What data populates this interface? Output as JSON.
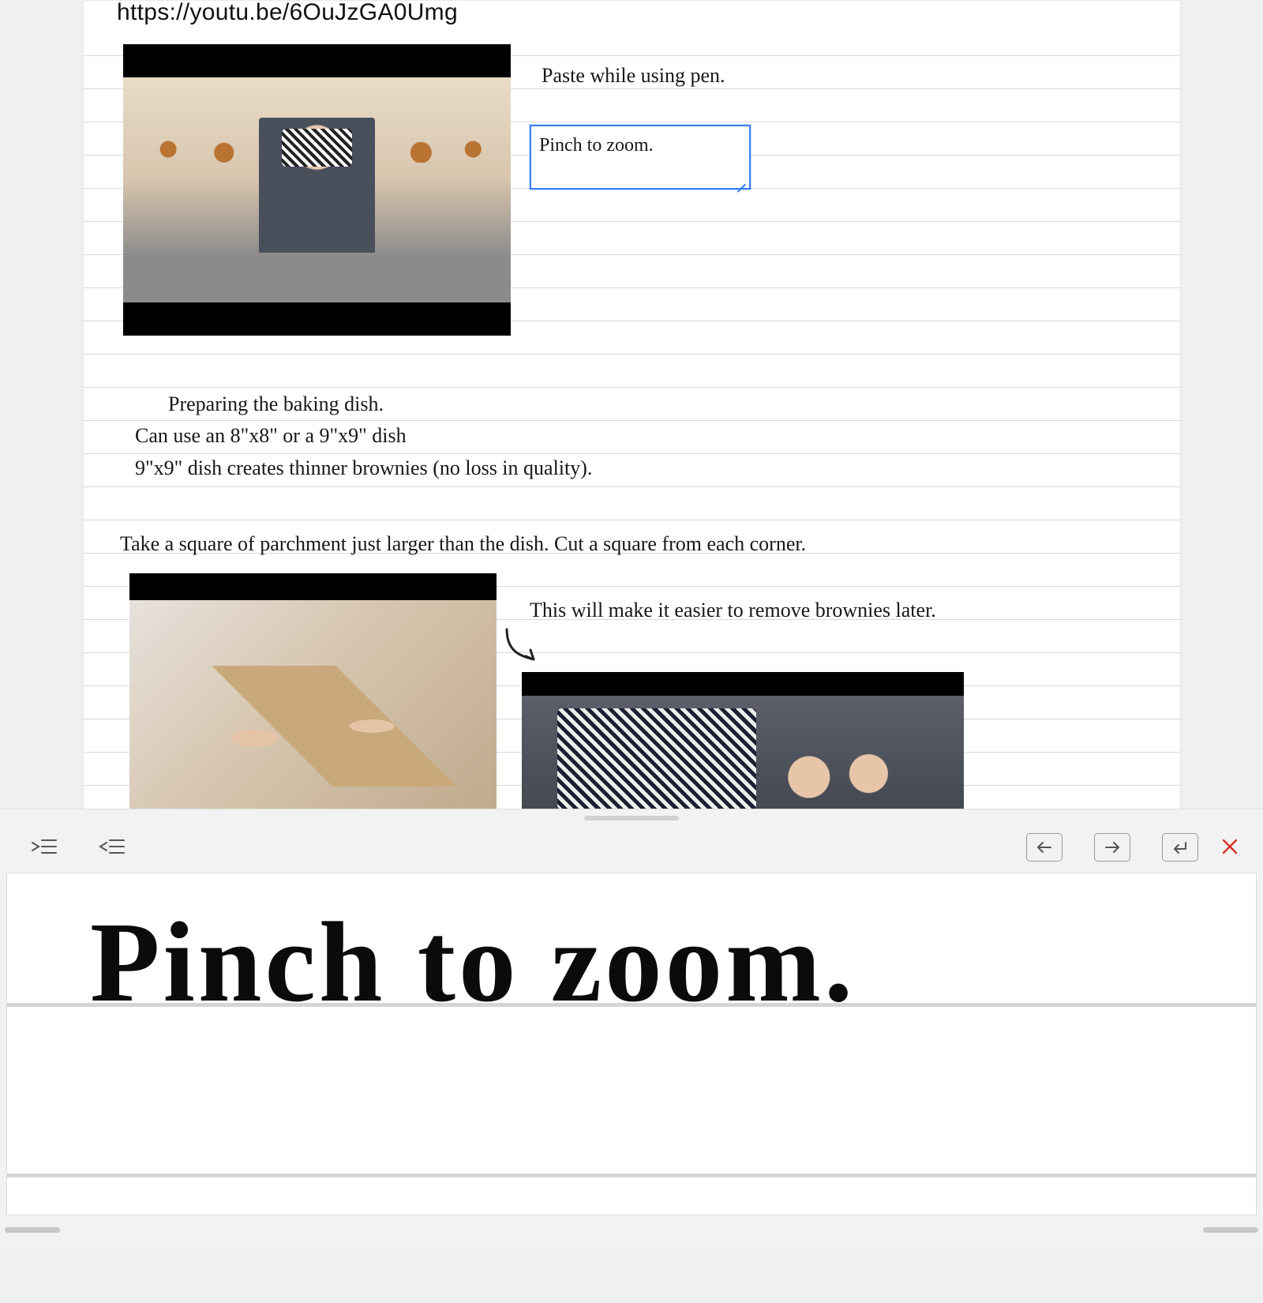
{
  "url": "https://youtu.be/6OuJzGA0Umg",
  "notes": {
    "paste_line": "Paste while using pen.",
    "zoom_box": "Pinch to zoom.",
    "prep_heading": "Preparing the baking dish.",
    "prep_l1": "Can use an 8\"x8\" or a 9\"x9\" dish",
    "prep_l2": "9\"x9\" dish creates thinner brownies (no loss in quality).",
    "parchment": "Take a square of parchment just larger than the dish. Cut a square from each corner.",
    "annot_remove": "This will make it easier to remove brownies later."
  },
  "panel": {
    "zoom_text": "Pinch to zoom.",
    "buttons": {
      "indent_right": "Indent right",
      "indent_left": "Indent left",
      "prev": "Previous",
      "next": "Next",
      "return": "Return",
      "close": "Close"
    }
  }
}
